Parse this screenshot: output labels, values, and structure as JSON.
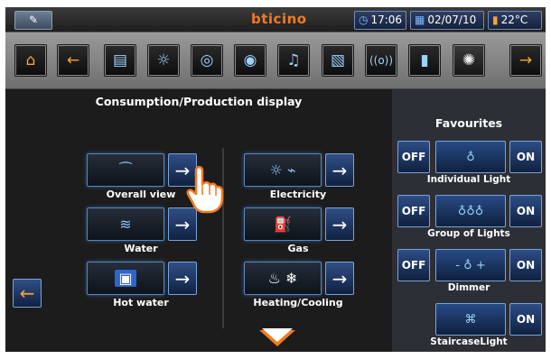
{
  "statusbar": {
    "brand": "bticino",
    "time": "17:06",
    "date": "02/07/10",
    "temperature": "22°C",
    "icons": {
      "pen": "pen-icon",
      "clock": "clock-icon",
      "calendar": "calendar-icon",
      "thermometer": "thermometer-icon"
    }
  },
  "toolbar": {
    "items": [
      {
        "name": "home-icon",
        "glyph": "⌂"
      },
      {
        "name": "back-arrow-icon",
        "glyph": "←"
      },
      {
        "name": "blinds-icon",
        "glyph": "▤"
      },
      {
        "name": "lighting-icon",
        "glyph": "☼"
      },
      {
        "name": "automation-icon",
        "glyph": "◎"
      },
      {
        "name": "scenario-icon",
        "glyph": "◉"
      },
      {
        "name": "multimedia-icon",
        "glyph": "♫"
      },
      {
        "name": "video-icon",
        "glyph": "▧"
      },
      {
        "name": "wireless-icon",
        "glyph": "((o))"
      },
      {
        "name": "temperature-icon",
        "glyph": "▮"
      },
      {
        "name": "energy-icon",
        "glyph": "✺"
      },
      {
        "name": "forward-arrow-icon",
        "glyph": "→"
      }
    ]
  },
  "main": {
    "title": "Consumption/Production display",
    "left": [
      {
        "label": "Overall view",
        "icon": "graph-icon",
        "glyph": "⁀"
      },
      {
        "label": "Water",
        "icon": "water-icon",
        "glyph": "≋"
      },
      {
        "label": "Hot water",
        "icon": "hot-water-icon",
        "glyph": "▣"
      }
    ],
    "right": [
      {
        "label": "Electricity",
        "icon": "electricity-icon",
        "glyph": "☼ ⌁"
      },
      {
        "label": "Gas",
        "icon": "gas-icon",
        "glyph": "⛽"
      },
      {
        "label": "Heating/Cooling",
        "icon": "heating-cooling-icon",
        "glyph": "♨ ❄"
      }
    ],
    "arrow_glyph": "→",
    "back_glyph": "←"
  },
  "favourites": {
    "title": "Favourites",
    "off_label": "OFF",
    "on_label": "ON",
    "items": [
      {
        "label": "Individual Light",
        "icon": "individual-light-icon",
        "glyph": "♁",
        "has_off": true
      },
      {
        "label": "Group of Lights",
        "icon": "group-of-lights-icon",
        "glyph": "♁♁♁",
        "has_off": true
      },
      {
        "label": "Dimmer",
        "icon": "dimmer-icon",
        "glyph": "- ♁ +",
        "has_off": true
      },
      {
        "label": "StaircaseLight",
        "icon": "staircase-light-icon",
        "glyph": "⌘",
        "has_off": false
      }
    ]
  },
  "colors": {
    "accent": "#f47a20",
    "button_blue": "#2d4d86",
    "glow": "#5c86b7"
  }
}
